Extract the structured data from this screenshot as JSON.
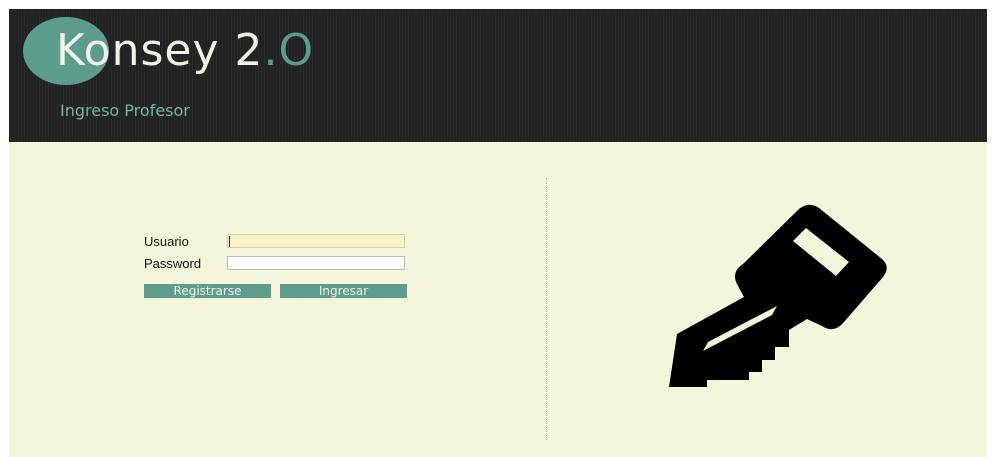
{
  "header": {
    "logo_text_main": "Konsey 2",
    "logo_text_dot": ".",
    "logo_text_o": "O",
    "subtitle": "Ingreso Profesor"
  },
  "login": {
    "username_label": "Usuario",
    "username_value": "",
    "password_label": "Password",
    "password_value": "",
    "register_button": "Registrarse",
    "login_button": "Ingresar"
  },
  "icons": {
    "logo": "logo-circle",
    "key": "key-icon"
  },
  "colors": {
    "accent": "#5b9c8d",
    "header_bg": "#222222",
    "page_bg": "#f3f5dc",
    "focused_field": "#fdf2c8"
  }
}
